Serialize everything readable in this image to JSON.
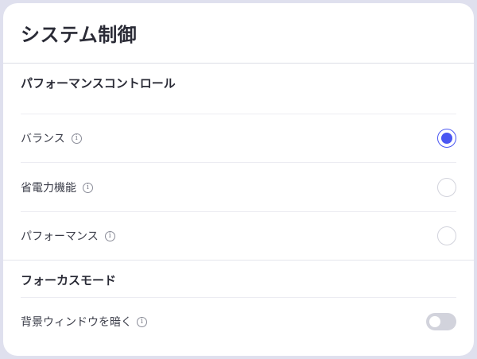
{
  "header": {
    "title": "システム制御"
  },
  "performance": {
    "title": "パフォーマンスコントロール",
    "options": [
      {
        "label": "バランス",
        "selected": true
      },
      {
        "label": "省電力機能",
        "selected": false
      },
      {
        "label": "パフォーマンス",
        "selected": false
      }
    ]
  },
  "focus": {
    "title": "フォーカスモード",
    "dim_background": {
      "label": "背景ウィンドウを暗く",
      "enabled": false
    }
  },
  "colors": {
    "accent": "#4a56f2",
    "toggle_off": "#d2d3dc",
    "background": "#dfe0ee"
  },
  "icons": {
    "info": "info-circle-icon"
  }
}
